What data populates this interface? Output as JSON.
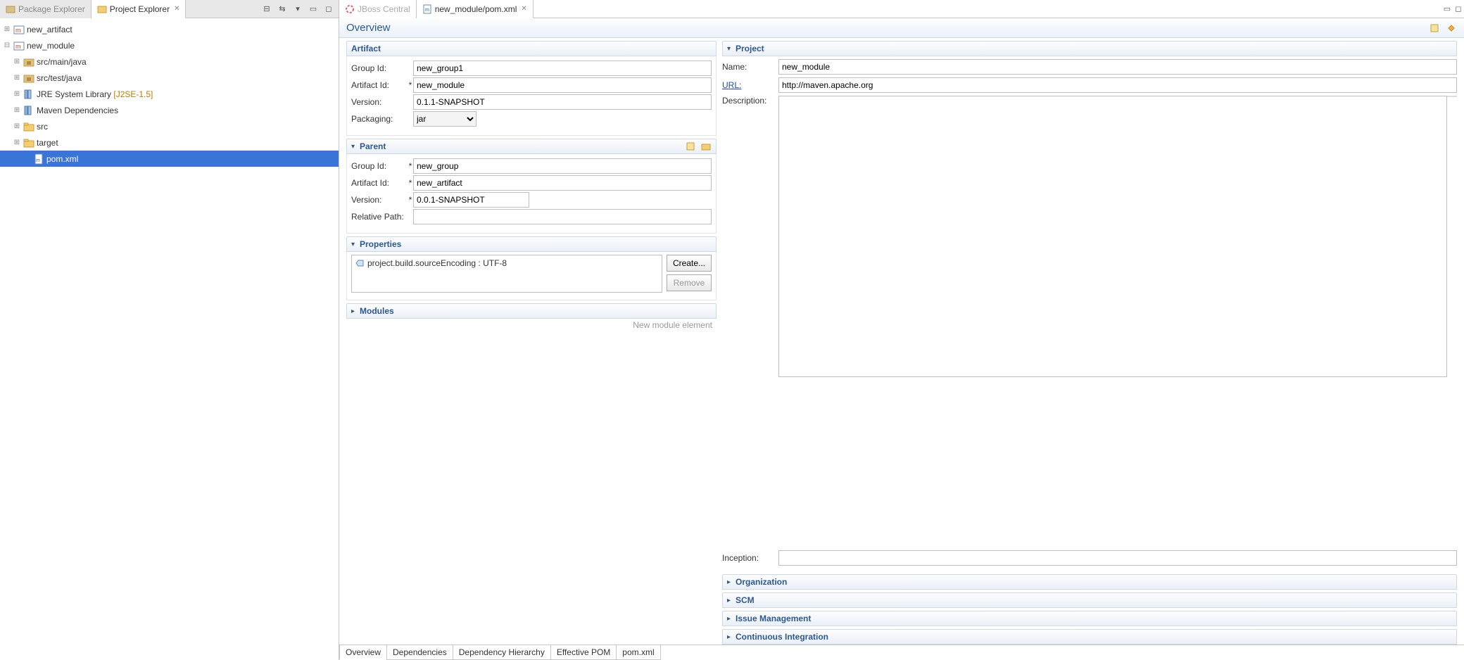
{
  "left_panel": {
    "tabs": [
      {
        "label": "Package Explorer",
        "active": false
      },
      {
        "label": "Project Explorer",
        "active": true
      }
    ],
    "toolbar_icons": [
      "collapse-all-icon",
      "link-editor-icon",
      "view-menu-icon",
      "minimize-icon",
      "maximize-icon"
    ],
    "tree": [
      {
        "id": "new_artifact",
        "label": "new_artifact",
        "icon": "maven-project-icon",
        "expander": "+",
        "indent": 1
      },
      {
        "id": "new_module",
        "label": "new_module",
        "icon": "maven-project-icon",
        "expander": "-",
        "indent": 1
      },
      {
        "id": "src_main_java",
        "label": "src/main/java",
        "icon": "package-folder-icon",
        "expander": "+",
        "indent": 2
      },
      {
        "id": "src_test_java",
        "label": "src/test/java",
        "icon": "package-folder-icon",
        "expander": "+",
        "indent": 2
      },
      {
        "id": "jre",
        "label": "JRE System Library",
        "decor": " [J2SE-1.5]",
        "icon": "library-icon",
        "expander": "+",
        "indent": 2
      },
      {
        "id": "maven_deps",
        "label": "Maven Dependencies",
        "icon": "library-icon",
        "expander": "+",
        "indent": 2
      },
      {
        "id": "src",
        "label": "src",
        "icon": "folder-icon",
        "expander": "+",
        "indent": 2
      },
      {
        "id": "target",
        "label": "target",
        "icon": "folder-icon",
        "expander": "+",
        "indent": 2
      },
      {
        "id": "pom",
        "label": "pom.xml",
        "icon": "xml-file-icon",
        "expander": "",
        "indent": 3,
        "selected": true
      }
    ]
  },
  "editor": {
    "tabs": [
      {
        "label": "JBoss Central",
        "active": false
      },
      {
        "label": "new_module/pom.xml",
        "active": true
      }
    ],
    "toolbar_icons": [
      "minimize-icon",
      "maximize-icon"
    ],
    "title": "Overview",
    "header_icons": [
      "open-parent-icon",
      "show-effective-icon"
    ]
  },
  "artifact": {
    "title": "Artifact",
    "group_id_label": "Group Id:",
    "group_id": "new_group1",
    "artifact_id_label": "Artifact Id:",
    "artifact_id": "new_module",
    "version_label": "Version:",
    "version": "0.1.1-SNAPSHOT",
    "packaging_label": "Packaging:",
    "packaging": "jar"
  },
  "parent": {
    "title": "Parent",
    "group_id_label": "Group Id:",
    "group_id": "new_group",
    "artifact_id_label": "Artifact Id:",
    "artifact_id": "new_artifact",
    "version_label": "Version:",
    "version": "0.0.1-SNAPSHOT",
    "relpath_label": "Relative Path:",
    "relpath": "",
    "action_icons": [
      "select-parent-icon",
      "open-parent-pom-icon"
    ]
  },
  "properties": {
    "title": "Properties",
    "items": [
      "project.build.sourceEncoding : UTF-8"
    ],
    "create_label": "Create...",
    "remove_label": "Remove"
  },
  "modules": {
    "title": "Modules",
    "hint": "New module element"
  },
  "project": {
    "title": "Project",
    "name_label": "Name:",
    "name": "new_module",
    "url_label": "URL:",
    "url": "http://maven.apache.org",
    "description_label": "Description:",
    "description": "",
    "inception_label": "Inception:",
    "inception": ""
  },
  "collapsed_sections": [
    "Organization",
    "SCM",
    "Issue Management",
    "Continuous Integration"
  ],
  "bottom_tabs": [
    "Overview",
    "Dependencies",
    "Dependency Hierarchy",
    "Effective POM",
    "pom.xml"
  ],
  "active_bottom_tab": 0
}
